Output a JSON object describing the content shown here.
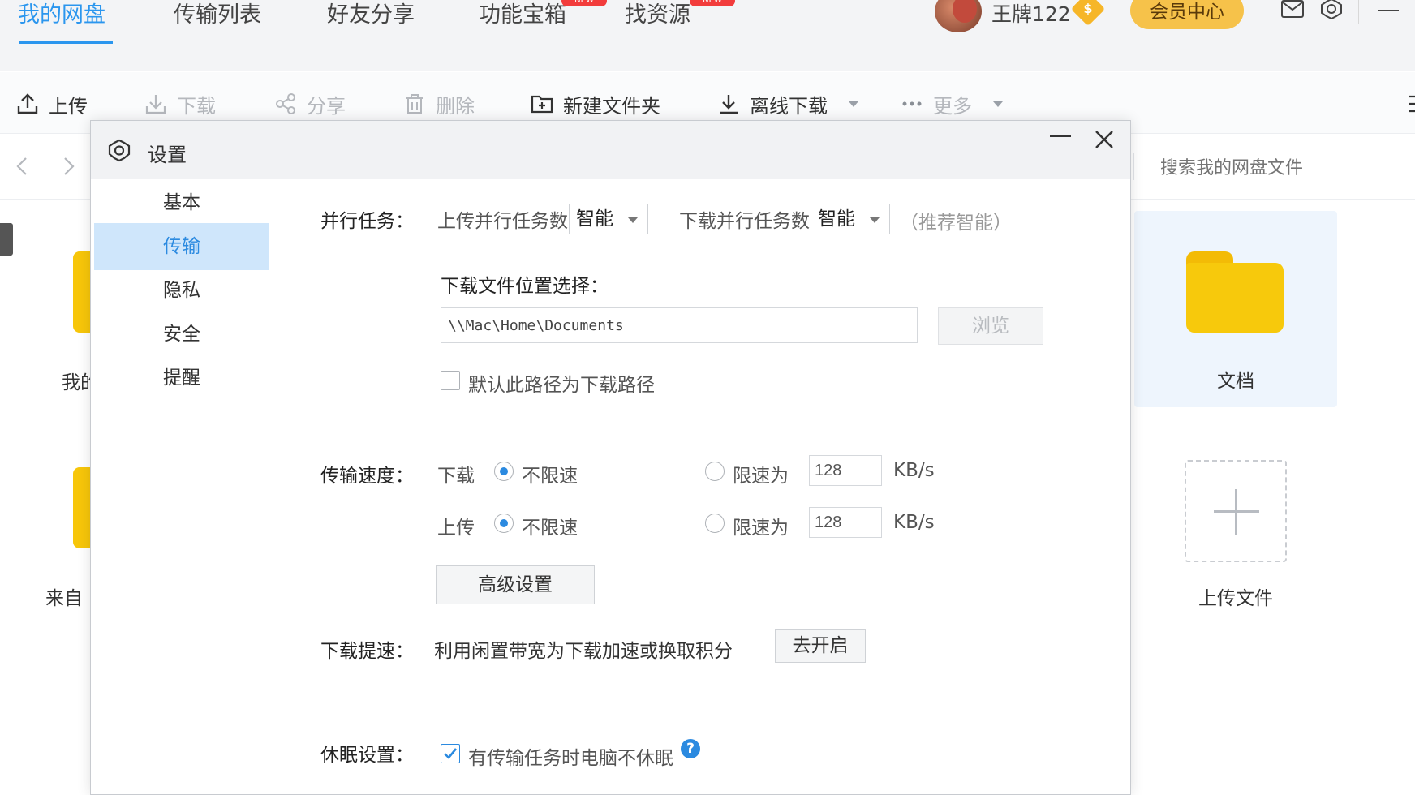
{
  "nav": {
    "tabs": [
      {
        "label": "我的网盘",
        "active": true
      },
      {
        "label": "传输列表"
      },
      {
        "label": "好友分享"
      },
      {
        "label": "功能宝箱",
        "badge": "NEW"
      },
      {
        "label": "找资源",
        "badge": "NEW"
      }
    ],
    "username": "王牌122",
    "vip_badge": "$",
    "vip_center": "会员中心"
  },
  "toolbar": {
    "upload": "上传",
    "download": "下载",
    "share": "分享",
    "delete": "删除",
    "new_folder": "新建文件夹",
    "offline_download": "离线下载",
    "more": "更多"
  },
  "address": {
    "search_placeholder": "搜索我的网盘文件"
  },
  "background_files": {
    "left_labels": [
      "我的",
      "来自"
    ],
    "folder_name": "文档",
    "upload_tile": "上传文件"
  },
  "dialog": {
    "title": "设置",
    "sidebar": [
      {
        "label": "基本"
      },
      {
        "label": "传输",
        "active": true
      },
      {
        "label": "隐私"
      },
      {
        "label": "安全"
      },
      {
        "label": "提醒"
      }
    ],
    "parallel": {
      "label": "并行任务：",
      "upload_label": "上传并行任务数",
      "upload_value": "智能",
      "download_label": "下载并行任务数",
      "download_value": "智能",
      "hint": "（推荐智能）"
    },
    "location": {
      "label": "下载文件位置选择：",
      "path": "\\\\Mac\\Home\\Documents",
      "browse": "浏览",
      "default_checkbox": "默认此路径为下载路径",
      "default_checked": false
    },
    "speed": {
      "label": "传输速度：",
      "download_label": "下载",
      "upload_label": "上传",
      "unlimited": "不限速",
      "limit_to": "限速为",
      "download_limit": "128",
      "upload_limit": "128",
      "unit": "KB/s",
      "download_mode": "unlimited",
      "upload_mode": "unlimited",
      "advanced": "高级设置"
    },
    "boost": {
      "label": "下载提速：",
      "description": "利用闲置带宽为下载加速或换取积分",
      "button": "去开启"
    },
    "sleep": {
      "label": "休眠设置：",
      "checkbox": "有传输任务时电脑不休眠",
      "checked": true,
      "help": "?"
    }
  },
  "colors": {
    "accent": "#2b8ae0",
    "nav_active": "#2b96ee",
    "vip": "#f6c24a",
    "folder": "#f7c90c",
    "badge": "#f23c3c"
  }
}
